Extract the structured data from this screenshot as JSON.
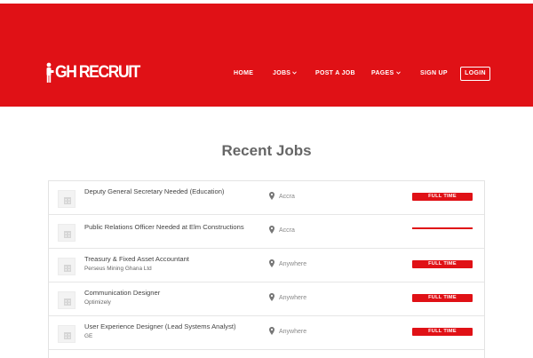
{
  "brand": {
    "logo_text": "GH RECRUIT",
    "accent_color": "#e01116"
  },
  "nav": {
    "items": [
      {
        "label": "HOME",
        "has_dropdown": false
      },
      {
        "label": "JOBS",
        "has_dropdown": true
      },
      {
        "label": "POST A JOB",
        "has_dropdown": false
      },
      {
        "label": "PAGES",
        "has_dropdown": true
      },
      {
        "label": "SIGN UP",
        "has_dropdown": false
      }
    ],
    "login_label": "LOGIN"
  },
  "section": {
    "title": "Recent Jobs"
  },
  "jobs": [
    {
      "title": "Deputy General Secretary Needed (Education)",
      "company": "",
      "location": "Accra",
      "type": "FULL TIME",
      "type_visible": true
    },
    {
      "title": "Public Relations Officer Needed at Elm Constructions",
      "company": "",
      "location": "Accra",
      "type": "",
      "type_visible": false
    },
    {
      "title": "Treasury & Fixed Asset Accountant",
      "company": "Perseus Mining Ghana Ltd",
      "location": "Anywhere",
      "type": "FULL TIME",
      "type_visible": true
    },
    {
      "title": "Communication Designer",
      "company": "Optimizely",
      "location": "Anywhere",
      "type": "FULL TIME",
      "type_visible": true
    },
    {
      "title": "User Experience Designer (Lead Systems Analyst)",
      "company": "GE",
      "location": "Anywhere",
      "type": "FULL TIME",
      "type_visible": true
    }
  ],
  "icons": {
    "location": "map-pin-icon",
    "company_placeholder": "building-icon",
    "dropdown": "chevron-down-icon"
  }
}
